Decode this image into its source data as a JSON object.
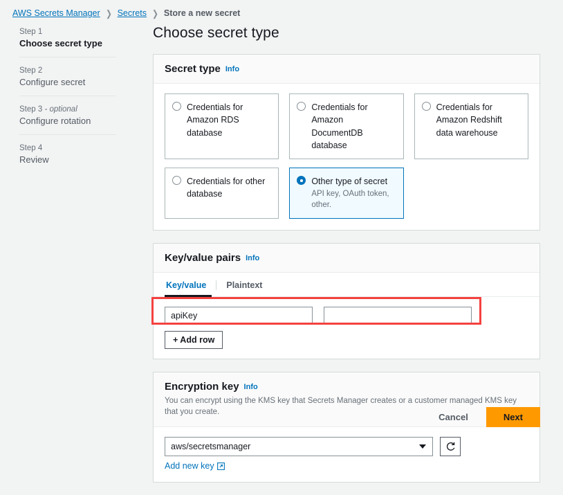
{
  "breadcrumb": {
    "items": [
      {
        "label": "AWS Secrets Manager",
        "type": "link"
      },
      {
        "label": "Secrets",
        "type": "link"
      },
      {
        "label": "Store a new secret",
        "type": "current"
      }
    ],
    "separator": "❯"
  },
  "sidebar": {
    "steps": [
      {
        "num": "Step 1",
        "optional": "",
        "title": "Choose secret type",
        "active": true
      },
      {
        "num": "Step 2",
        "optional": "",
        "title": "Configure secret",
        "active": false
      },
      {
        "num": "Step 3",
        "optional": " - optional",
        "title": "Configure rotation",
        "active": false
      },
      {
        "num": "Step 4",
        "optional": "",
        "title": "Review",
        "active": false
      }
    ]
  },
  "page": {
    "title": "Choose secret type"
  },
  "secret_type": {
    "title": "Secret type",
    "info_label": "Info",
    "options": [
      {
        "label": "Credentials for Amazon RDS database",
        "sub": "",
        "selected": false
      },
      {
        "label": "Credentials for Amazon DocumentDB database",
        "sub": "",
        "selected": false
      },
      {
        "label": "Credentials for Amazon Redshift data warehouse",
        "sub": "",
        "selected": false
      },
      {
        "label": "Credentials for other database",
        "sub": "",
        "selected": false
      },
      {
        "label": "Other type of secret",
        "sub": "API key, OAuth token, other.",
        "selected": true
      }
    ]
  },
  "key_value_pairs": {
    "title": "Key/value pairs",
    "info_label": "Info",
    "tabs": [
      {
        "label": "Key/value",
        "active": true
      },
      {
        "label": "Plaintext",
        "active": false
      }
    ],
    "row": {
      "key_value": "apiKey",
      "key_placeholder": "",
      "value_value": "",
      "value_placeholder": ""
    },
    "add_row_label": "+ Add row",
    "highlight_color": "#f4413f"
  },
  "encryption_key": {
    "title": "Encryption key",
    "info_label": "Info",
    "description": "You can encrypt using the KMS key that Secrets Manager creates or a customer managed KMS key that you create.",
    "selected_key": "aws/secretsmanager",
    "refresh_label": "",
    "add_new_key_label": "Add new key"
  },
  "footer": {
    "cancel_label": "Cancel",
    "next_label": "Next",
    "next_color": "#ff9900"
  }
}
